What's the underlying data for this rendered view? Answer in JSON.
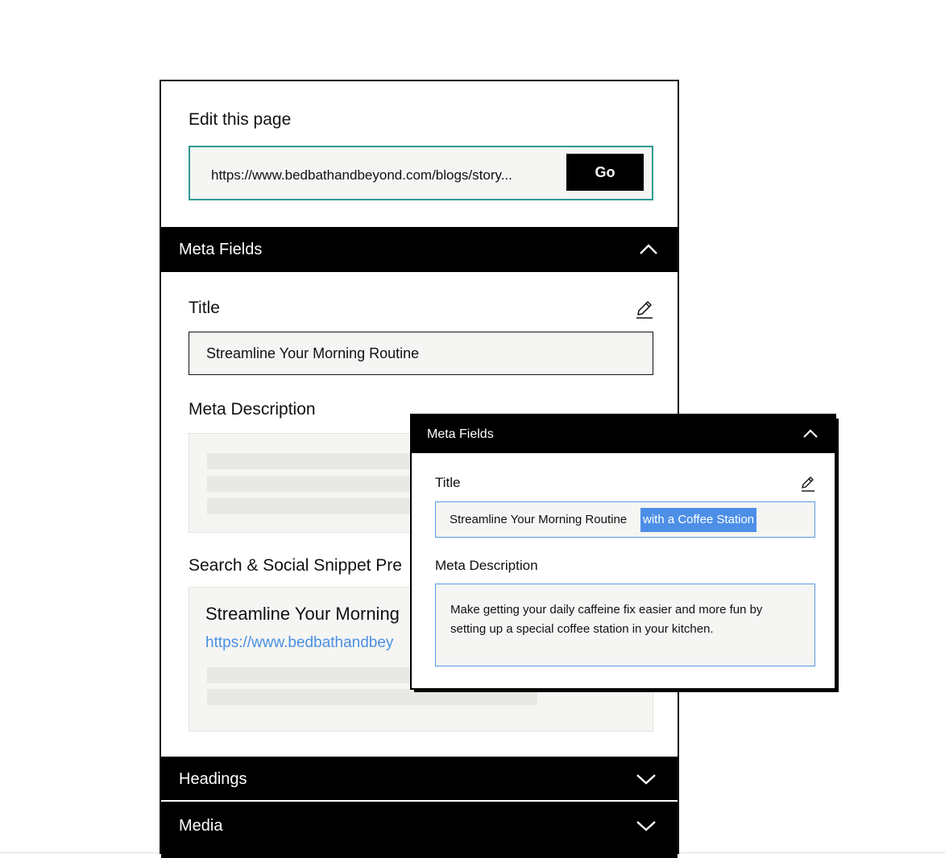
{
  "editor": {
    "heading": "Edit this page",
    "url_value": "https://www.bedbathandbeyond.com/blogs/story...",
    "go_label": "Go"
  },
  "meta_fields": {
    "section_label": "Meta Fields",
    "title_label": "Title",
    "title_value": "Streamline Your Morning Routine",
    "meta_description_label": "Meta Description",
    "snippet_label": "Search & Social Snippet Pre",
    "snippet_title": "Streamline Your Morning",
    "snippet_url": "https://www.bedbathandbey"
  },
  "sections": {
    "headings_label": "Headings",
    "media_label": "Media"
  },
  "popup": {
    "section_label": "Meta Fields",
    "title_label": "Title",
    "title_value": "Streamline Your Morning Routine",
    "title_selected_text": "with a Coffee Station",
    "meta_description_label": "Meta Description",
    "meta_description_value": "Make getting your daily caffeine fix easier and more fun by setting up a special coffee station in your kitchen."
  },
  "colors": {
    "accent_teal": "#2e9a92",
    "link_blue": "#4a8fe0",
    "selection_blue": "#4d8fe6",
    "bar_black": "#000000"
  },
  "icons": [
    "chevron-up-icon",
    "chevron-down-icon",
    "pencil-icon"
  ]
}
